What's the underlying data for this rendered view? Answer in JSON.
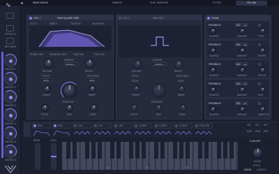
{
  "top": {
    "logo": "∿",
    "tabs": [
      "WAVETABLES",
      "SAMPLE",
      "SUB / SAMPLER",
      "FILTER",
      "FM / AM"
    ]
  },
  "sidebar": {
    "icons": [
      "keyboard-icon",
      "settings-icon",
      "browser-icon"
    ],
    "icon_labels": [
      "",
      "EFFECTS",
      "SETTINGS"
    ],
    "macros": [
      "MACRO 1",
      "MACRO 2",
      "MACRO 3",
      "MACRO 4",
      "MACRO 5",
      "MACRO 6"
    ]
  },
  "osc1": {
    "title": "OSC 1",
    "wavetable": "SAW SQUARE SINE",
    "oct": "OCT  0",
    "semi": "SEMI  0",
    "tune": "TUNE  0ct",
    "blend": "BLEND  0%",
    "phase": "PHASE  180°",
    "random": "RANDOM  100%",
    "fade": "FADE  0%",
    "fold": "FOLD  0%",
    "knobs": [
      "DETUNE",
      "WIDTH"
    ],
    "unison_label": "UNISON",
    "unison_value": "VOICES  2",
    "pitch": "PITCH",
    "spectral": "SPECTRAL",
    "scan": "SCAN",
    "data": "DATA",
    "position": "POSITION",
    "bottom_knobs": [
      "PITCH",
      "PAN",
      "LEVEL"
    ],
    "mid_knobs": [
      "SHAPE",
      "WARP"
    ]
  },
  "osc2": {
    "title": "OSC 2",
    "mode": "INACTIVE",
    "knobs": [
      "DETUNE",
      "WIDTH"
    ],
    "unison_label": "UNISON",
    "unison_value": "VOICES  1",
    "pitch": "PITCH",
    "spectral": "SPECTRAL",
    "scan": "SCAN",
    "data": "FADE",
    "position": "POSITION",
    "bottom_knobs": [
      "PITCH",
      "PAN",
      "LEVEL"
    ],
    "mid_knobs": [
      "SHAPE",
      "WARP"
    ]
  },
  "fx": {
    "title": "FM/AM",
    "slots": [
      {
        "label": "FEEDBACK",
        "a": "FM",
        "b": "AM",
        "source": "SOURCE",
        "amount": "AMOUNT",
        "mode": "TYPE"
      },
      {
        "label": "FEEDBACK",
        "a": "FM",
        "b": "AM",
        "source": "SOURCE",
        "amount": "AMOUNT",
        "mode": "SHAPE"
      },
      {
        "label": "FEEDBACK",
        "a": "FM",
        "b": "AM",
        "source": "SOURCE",
        "amount": "AMOUNT",
        "mode": "ROUTE"
      },
      {
        "label": "FEEDBACK",
        "a": "FM",
        "b": "AM",
        "source": "SOURCE",
        "amount": "AMOUNT",
        "mode": "SUB"
      },
      {
        "label": "FEEDBACK",
        "a": "FM",
        "b": "AM",
        "source": "SOURCE",
        "amount": "AMOUNT",
        "mode": "SAMPLER"
      }
    ]
  },
  "mod": {
    "slots": [
      "ENV",
      "ENV",
      "LFO",
      "LFO",
      "LFO",
      "CURVE",
      "CURVE",
      "CURVE",
      "FOLLOW"
    ],
    "right": [
      "VEL",
      "KEY",
      "AFT",
      "MOD",
      "RND",
      "PBD"
    ]
  },
  "keys": {
    "bend": "BEND",
    "mod": "MOD",
    "octaves": [
      "C2",
      "C3",
      "C4"
    ],
    "scale": "C MAJOR",
    "pitch": "PITCH",
    "mono": "MONO",
    "legato": "LEGATO",
    "glide": "GLIDE"
  },
  "colors": {
    "accent": "#8b7ff0",
    "bg": "#1b1e2c",
    "panel": "#262a3d"
  }
}
